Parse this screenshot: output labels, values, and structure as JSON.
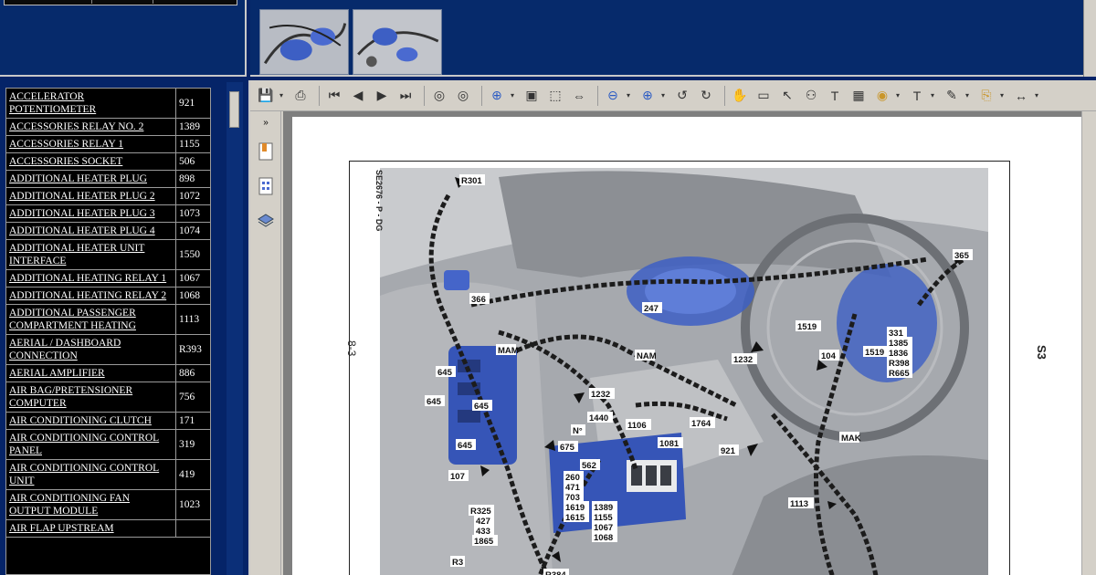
{
  "index_list": [
    {
      "name": "ACCELERATOR POTENTIOMETER",
      "num": "921"
    },
    {
      "name": "ACCESSORIES RELAY NO. 2",
      "num": "1389"
    },
    {
      "name": "ACCESSORIES RELAY 1",
      "num": "1155"
    },
    {
      "name": "ACCESSORIES SOCKET",
      "num": "506"
    },
    {
      "name": "ADDITIONAL HEATER PLUG",
      "num": "898"
    },
    {
      "name": "ADDITIONAL HEATER PLUG 2",
      "num": "1072"
    },
    {
      "name": "ADDITIONAL HEATER PLUG 3",
      "num": "1073"
    },
    {
      "name": "ADDITIONAL HEATER PLUG 4",
      "num": "1074"
    },
    {
      "name": "ADDITIONAL HEATER UNIT INTERFACE",
      "num": "1550"
    },
    {
      "name": "ADDITIONAL HEATING RELAY 1",
      "num": "1067"
    },
    {
      "name": "ADDITIONAL HEATING RELAY 2",
      "num": "1068"
    },
    {
      "name": "ADDITIONAL PASSENGER COMPARTMENT HEATING",
      "num": "1113"
    },
    {
      "name": "AERIAL / DASHBOARD CONNECTION",
      "num": "R393"
    },
    {
      "name": "AERIAL AMPLIFIER",
      "num": "886"
    },
    {
      "name": "AIR BAG/PRETENSIONER COMPUTER",
      "num": "756"
    },
    {
      "name": "AIR CONDITIONING CLUTCH",
      "num": "171"
    },
    {
      "name": "AIR CONDITIONING CONTROL PANEL",
      "num": "319"
    },
    {
      "name": "AIR CONDITIONING CONTROL UNIT",
      "num": "419"
    },
    {
      "name": "AIR CONDITIONING FAN OUTPUT MODULE",
      "num": "1023"
    },
    {
      "name": "AIR FLAP UPSTREAM",
      "num": ""
    }
  ],
  "page": {
    "left_margin_label": "8-3",
    "right_margin_label": "S3",
    "figure_code": "SE2676 - P - DG"
  },
  "figure_labels": {
    "l1": "R301",
    "l2": "366",
    "l3": "MAM",
    "l4": "645",
    "l5": "645",
    "l6": "645",
    "l7": "645",
    "l8": "1232",
    "l9": "1440",
    "l10": "N°",
    "l11": "675",
    "l12": "1106",
    "l13": "1764",
    "l14": "1081",
    "l15": "562",
    "l16": "260",
    "l17": "471",
    "l18": "703",
    "l19": "1619",
    "l20": "1615",
    "l21": "1389",
    "l22": "1155",
    "l23": "1067",
    "l24": "1068",
    "l25": "107",
    "l26": "R325",
    "l27": "427",
    "l28": "433",
    "l29": "1865",
    "l30": "R3",
    "l31": "R384",
    "l32": "247",
    "l33": "NAM",
    "l34": "1232",
    "l35": "1519",
    "l36": "104",
    "l37": "1519",
    "l38": "331",
    "l39": "1385",
    "l40": "1836",
    "l41": "R398",
    "l42": "R665",
    "l43": "365",
    "l44": "921",
    "l45": "MAK",
    "l46": "1113"
  },
  "toolbar_icons": [
    "save-icon",
    "print-icon",
    "first-page-icon",
    "prev-page-icon",
    "next-page-icon",
    "last-page-icon",
    "back-icon",
    "forward-icon",
    "zoom-in-icon",
    "actual-size-icon",
    "fit-page-icon",
    "fit-width-icon",
    "zoom-out-circle-icon",
    "zoom-in-circle-icon",
    "rotate-left-icon",
    "rotate-right-icon",
    "hand-icon",
    "glasses-icon",
    "select-icon",
    "binoculars-icon",
    "text-select-icon",
    "snapshot-icon",
    "stamp-icon",
    "text-box-icon",
    "note-icon",
    "attach-icon",
    "measure-icon"
  ],
  "colors": {
    "background": "#052468",
    "list_bg": "#000000",
    "harness_blue": "#3d5fc4"
  }
}
